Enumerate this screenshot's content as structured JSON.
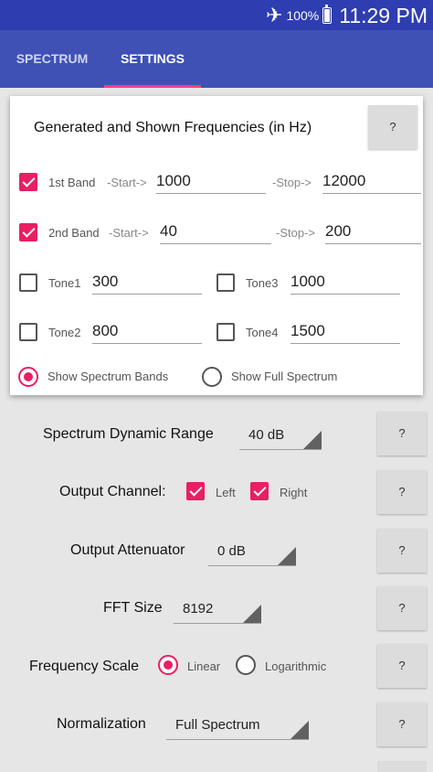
{
  "status_bar": {
    "airplane_icon": "airplane-icon",
    "battery_text": "100%",
    "battery_icon": "battery-icon",
    "time": "11:29 PM"
  },
  "tabs": [
    {
      "label": "SPECTRUM",
      "active": false
    },
    {
      "label": "SETTINGS",
      "active": true
    }
  ],
  "frequencies_card": {
    "title": "Generated and Shown Frequencies (in Hz)",
    "help_label": "?",
    "band1": {
      "label": "1st Band",
      "start_label": "-Start->",
      "start": "1000",
      "stop_label": "-Stop->",
      "stop": "12000",
      "checked": true
    },
    "band2": {
      "label": "2nd Band",
      "start_label": "-Start->",
      "start": "40",
      "stop_label": "-Stop->",
      "stop": "200",
      "checked": true
    },
    "tone1": {
      "label": "Tone1",
      "value": "300",
      "checked": false
    },
    "tone2": {
      "label": "Tone2",
      "value": "800",
      "checked": false
    },
    "tone3": {
      "label": "Tone3",
      "value": "1000",
      "checked": false
    },
    "tone4": {
      "label": "Tone4",
      "value": "1500",
      "checked": false
    },
    "show_bands": {
      "label": "Show Spectrum Bands",
      "selected": true
    },
    "show_full": {
      "label": "Show Full Spectrum",
      "selected": false
    }
  },
  "settings": {
    "dynamic_range": {
      "label": "Spectrum Dynamic Range",
      "value": "40 dB",
      "help": "?"
    },
    "output_channel": {
      "label": "Output Channel:",
      "left": "Left",
      "right": "Right",
      "left_checked": true,
      "right_checked": true,
      "help": "?"
    },
    "attenuator": {
      "label": "Output Attenuator",
      "value": "0 dB",
      "help": "?"
    },
    "fft": {
      "label": "FFT Size",
      "value": "8192",
      "help": "?"
    },
    "freq_scale": {
      "label": "Frequency Scale",
      "linear": "Linear",
      "log": "Logarithmic",
      "linear_selected": true,
      "help": "?"
    },
    "normalization": {
      "label": "Normalization",
      "value": "Full Spectrum",
      "help": "?"
    }
  },
  "colors": {
    "statusbar": "#2e3db0",
    "appbar": "#3f51b5",
    "accent": "#e91e63",
    "tab_indicator": "#ff3d7f",
    "background": "#e6e6e6"
  }
}
